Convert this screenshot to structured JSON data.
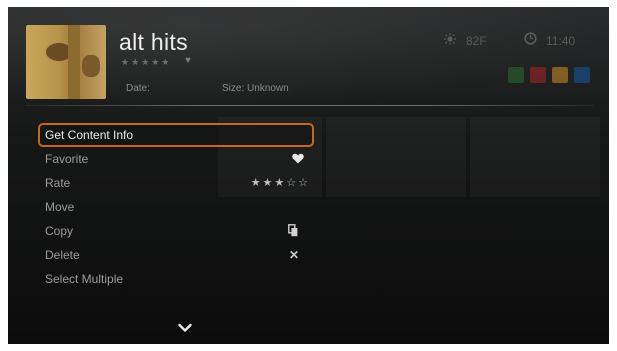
{
  "header": {
    "title": "alt hits",
    "rating_stars": "★★★★★",
    "date_label": "Date:",
    "size_label": "Size: Unknown"
  },
  "status": {
    "temperature": "82F",
    "time": "11:40",
    "color_keys": [
      "#2e7d32",
      "#c62828",
      "#f9a825",
      "#1565c0"
    ]
  },
  "menu": {
    "items": [
      {
        "label": "Get Content Info",
        "selected": true
      },
      {
        "label": "Favorite",
        "trail_icon": "heart-icon"
      },
      {
        "label": "Rate",
        "trail_text": "★★★☆☆"
      },
      {
        "label": "Move"
      },
      {
        "label": "Copy",
        "trail_icon": "copy-icon"
      },
      {
        "label": "Delete",
        "trail_text": "✕"
      },
      {
        "label": "Select Multiple"
      }
    ]
  },
  "colors": {
    "accent": "#c9651e"
  }
}
